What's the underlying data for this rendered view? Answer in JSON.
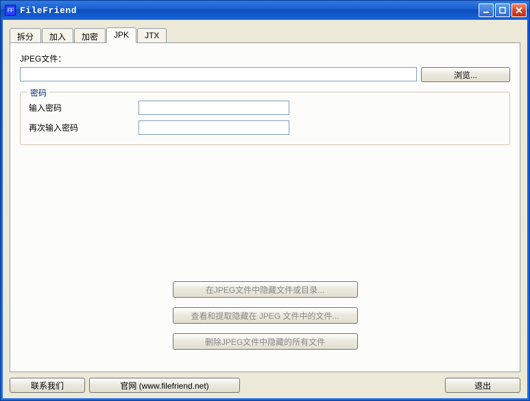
{
  "window": {
    "title": "FileFriend",
    "app_icon_text": "FF"
  },
  "tabs": {
    "items": [
      {
        "label": "拆分"
      },
      {
        "label": "加入"
      },
      {
        "label": "加密"
      },
      {
        "label": "JPK"
      },
      {
        "label": "JTX"
      }
    ],
    "active_index": 3
  },
  "jpk": {
    "file_label": "JPEG文件：",
    "file_value": "",
    "browse_label": "浏览...",
    "password_group": "密码",
    "pw1_label": "输入密码",
    "pw1_value": "",
    "pw2_label": "再次输入密码",
    "pw2_value": "",
    "btn_hide": "在JPEG文件中隐藏文件或目录...",
    "btn_extract": "查看和提取隐藏在 JPEG 文件中的文件...",
    "btn_delete": "删除JPEG文件中隐藏的所有文件"
  },
  "bottom": {
    "contact": "联系我们",
    "site": "官网 (www.filefriend.net)",
    "exit": "退出"
  }
}
